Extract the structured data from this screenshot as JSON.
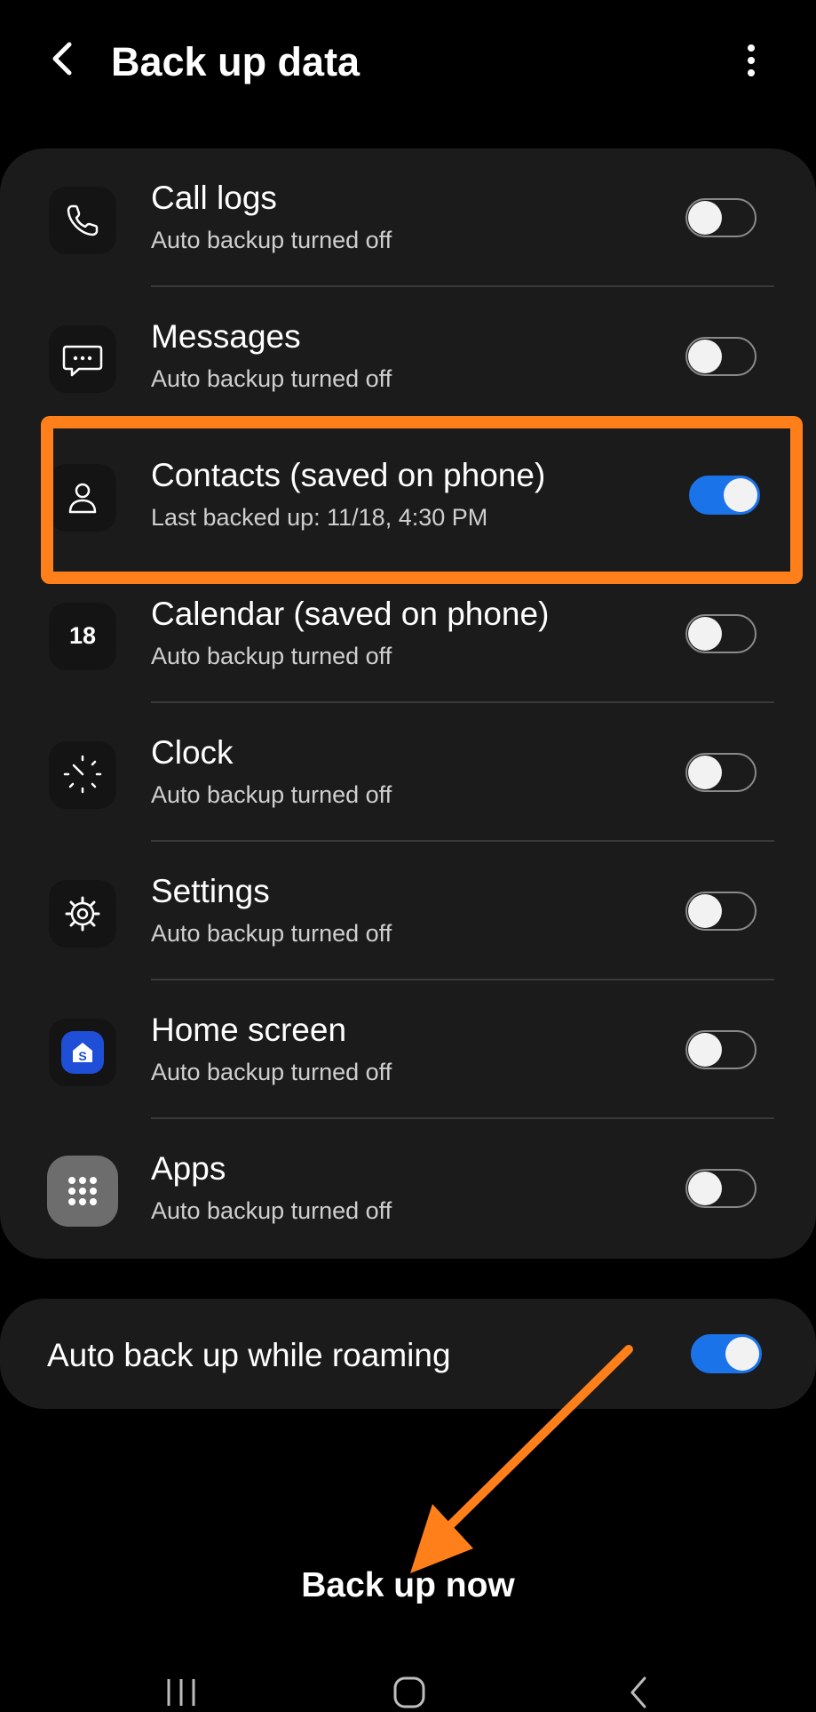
{
  "header": {
    "title": "Back up data"
  },
  "items": [
    {
      "label": "Call logs",
      "status": "Auto backup turned off",
      "icon": "phone-icon",
      "enabled": false
    },
    {
      "label": "Messages",
      "status": "Auto backup turned off",
      "icon": "message-icon",
      "enabled": false
    },
    {
      "label": "Contacts (saved on phone)",
      "status": "Last backed up: 11/18, 4:30 PM",
      "icon": "person-icon",
      "enabled": true
    },
    {
      "label": "Calendar (saved on phone)",
      "status": "Auto backup turned off",
      "icon": "calendar-icon",
      "icon_text": "18",
      "enabled": false
    },
    {
      "label": "Clock",
      "status": "Auto backup turned off",
      "icon": "clock-icon",
      "enabled": false
    },
    {
      "label": "Settings",
      "status": "Auto backup turned off",
      "icon": "gear-icon",
      "enabled": false
    },
    {
      "label": "Home screen",
      "status": "Auto backup turned off",
      "icon": "home-screen-icon",
      "enabled": false
    },
    {
      "label": "Apps",
      "status": "Auto backup turned off",
      "icon": "apps-grid-icon",
      "enabled": false
    }
  ],
  "roaming": {
    "label": "Auto back up while roaming",
    "enabled": true
  },
  "action": {
    "label": "Back up now"
  },
  "colors": {
    "accent": "#1a73e8",
    "highlight": "#ff7f1a",
    "card": "#1b1b1b"
  }
}
